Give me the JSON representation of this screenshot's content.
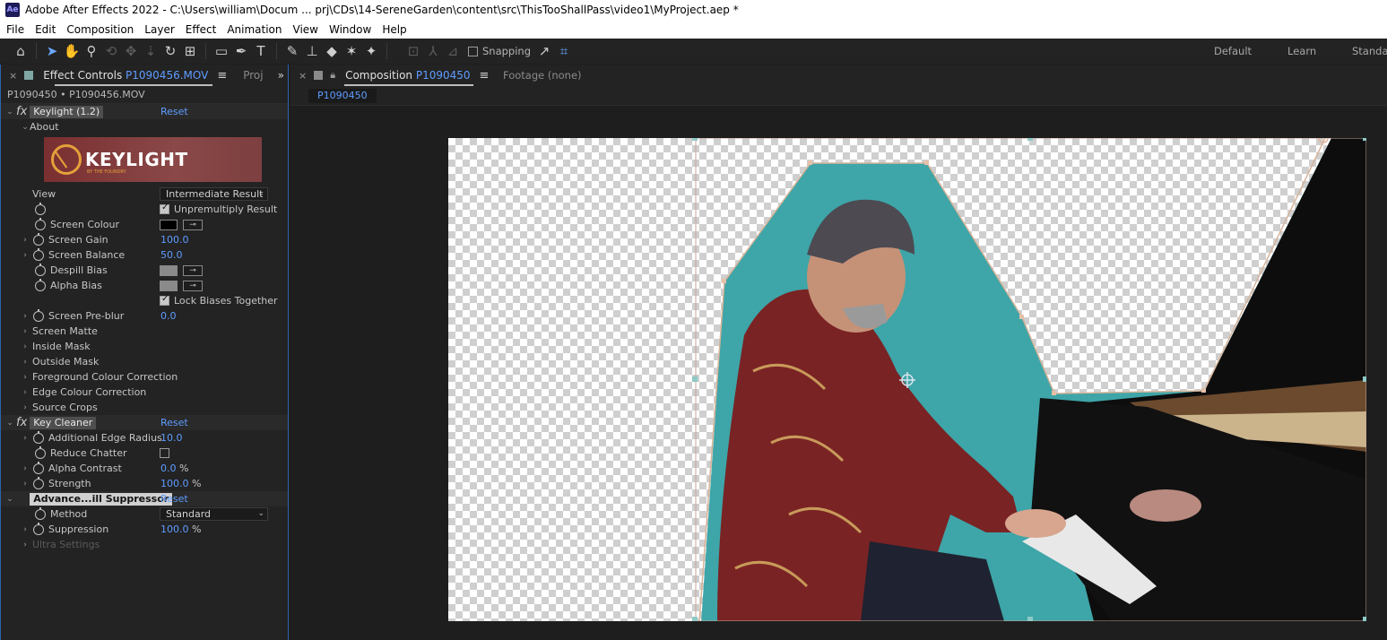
{
  "window": {
    "app_icon": "Ae",
    "title": "Adobe After Effects 2022 - C:\\Users\\william\\Docum ... prj\\CDs\\14-SereneGarden\\content\\src\\ThisTooShallPass\\video1\\MyProject.aep *"
  },
  "menu": [
    "File",
    "Edit",
    "Composition",
    "Layer",
    "Effect",
    "Animation",
    "View",
    "Window",
    "Help"
  ],
  "toolbar": {
    "snapping_label": "Snapping",
    "workspaces": [
      "Default",
      "Learn",
      "Standar"
    ]
  },
  "effect_controls": {
    "tab_label": "Effect Controls",
    "tab_layer": "P1090456.MOV",
    "second_tab": "Proj",
    "layer_path": "P1090450 • P1090456.MOV",
    "keylight": {
      "name": "Keylight (1.2)",
      "reset": "Reset",
      "about": "About",
      "logo_word": "KEYLIGHT",
      "logo_small": "BY THE FOUNDRY",
      "view_label": "View",
      "view_value": "Intermediate Result",
      "unpremultiply": "Unpremultiply Result",
      "screen_colour": "Screen Colour",
      "screen_gain": "Screen Gain",
      "screen_gain_value": "100.0",
      "screen_balance": "Screen Balance",
      "screen_balance_value": "50.0",
      "despill_bias": "Despill Bias",
      "alpha_bias": "Alpha Bias",
      "lock_biases": "Lock Biases Together",
      "screen_preblur": "Screen Pre-blur",
      "screen_preblur_value": "0.0",
      "groups": [
        "Screen Matte",
        "Inside Mask",
        "Outside Mask",
        "Foreground Colour Correction",
        "Edge Colour Correction",
        "Source Crops"
      ]
    },
    "key_cleaner": {
      "name": "Key Cleaner",
      "reset": "Reset",
      "additional_edge_radius": "Additional Edge Radius",
      "additional_edge_radius_value": "10.0",
      "reduce_chatter": "Reduce Chatter",
      "alpha_contrast": "Alpha Contrast",
      "alpha_contrast_value": "0.0",
      "strength": "Strength",
      "strength_value": "100.0",
      "percent": "%"
    },
    "spill_suppressor": {
      "name": "Advance...ill Suppressor",
      "reset": "Reset",
      "method": "Method",
      "method_value": "Standard",
      "suppression": "Suppression",
      "suppression_value": "100.0",
      "ultra_settings": "Ultra Settings"
    }
  },
  "composition": {
    "tab_label": "Composition",
    "tab_comp": "P1090450",
    "footage_tab": "Footage (none)",
    "chip": "P1090450"
  },
  "colors": {
    "accent_blue": "#5f9cff",
    "panel_bg": "#232323",
    "green_screen": "#3ea5a8"
  }
}
